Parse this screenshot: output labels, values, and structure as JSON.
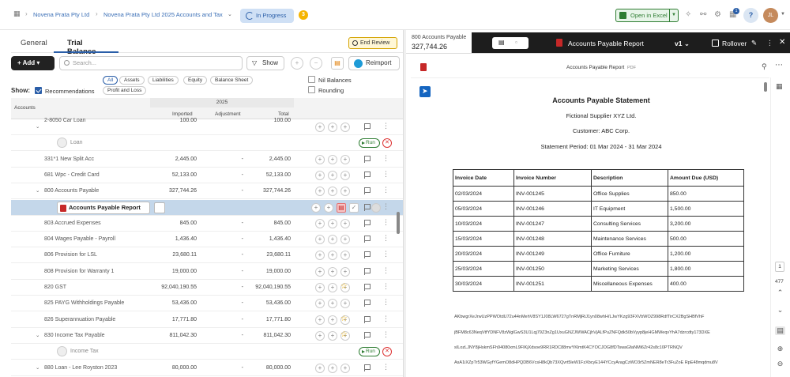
{
  "breadcrumb": {
    "client": "Novena Prata Pty Ltd",
    "file": "Novena Prata Pty Ltd 2025 Accounts and Tax",
    "status": "In Progress",
    "status_count": "3"
  },
  "top_actions": {
    "open_excel": "Open in Excel",
    "notifications": "1",
    "help": "?",
    "user_initials": "JL"
  },
  "tabs": [
    {
      "label": "General"
    },
    {
      "label": "Trial Balance"
    }
  ],
  "end_review": "End Review",
  "toolbar": {
    "add": "Add",
    "search_placeholder": "Search...",
    "show": "Show",
    "reimport": "Reimport"
  },
  "filters": {
    "show_label": "Show:",
    "recommendations": "Recommendations",
    "chips": [
      "All",
      "Assets",
      "Liabilities",
      "Equity",
      "Balance Sheet",
      "Profit and Loss"
    ],
    "nil_balances": "Nil Balances",
    "rounding": "Rounding"
  },
  "table": {
    "accounts_header": "Accounts",
    "year": "2025",
    "col_imported": "Imported",
    "col_adjustment": "Adjustment",
    "col_total": "Total"
  },
  "rows": [
    {
      "type": "account",
      "name": "2-8050 Car Loan",
      "imported": "100.00",
      "adjustment": "",
      "total": "100.00",
      "chev": true,
      "cut": true
    },
    {
      "type": "task",
      "name": "Loan",
      "run": "Run"
    },
    {
      "type": "account",
      "name": "331*1 New Split Acc",
      "imported": "2,445.00",
      "adjustment": "-",
      "total": "2,445.00"
    },
    {
      "type": "account",
      "name": "681 Wpc - Credit Card",
      "imported": "52,133.00",
      "adjustment": "-",
      "total": "52,133.00"
    },
    {
      "type": "account",
      "name": "800 Accounts Payable",
      "imported": "327,744.26",
      "adjustment": "-",
      "total": "327,744.26",
      "chev": true
    },
    {
      "type": "report",
      "name": "Accounts Payable Report"
    },
    {
      "type": "account",
      "name": "803 Accrued Expenses",
      "imported": "845.00",
      "adjustment": "-",
      "total": "845.00"
    },
    {
      "type": "account",
      "name": "804 Wages Payable - Payroll",
      "imported": "1,436.40",
      "adjustment": "-",
      "total": "1,436.40"
    },
    {
      "type": "account",
      "name": "806 Provision for LSL",
      "imported": "23,680.11",
      "adjustment": "-",
      "total": "23,680.11"
    },
    {
      "type": "account",
      "name": "808 Provision for Warranty 1",
      "imported": "19,000.00",
      "adjustment": "-",
      "total": "19,000.00"
    },
    {
      "type": "account",
      "name": "820 GST",
      "imported": "92,040,190.55",
      "adjustment": "-",
      "total": "92,040,190.55",
      "star": true
    },
    {
      "type": "account",
      "name": "825 PAYG Withholdings Payable",
      "imported": "53,436.00",
      "adjustment": "-",
      "total": "53,436.00"
    },
    {
      "type": "account",
      "name": "826 Superannuation Payable",
      "imported": "17,771.80",
      "adjustment": "-",
      "total": "17,771.80",
      "star": true
    },
    {
      "type": "account",
      "name": "830 Income Tax Payable",
      "imported": "811,042.30",
      "adjustment": "-",
      "total": "811,042.30",
      "chev": true,
      "star": true
    },
    {
      "type": "task",
      "name": "Income Tax",
      "run": "Run"
    },
    {
      "type": "account",
      "name": "880 Loan - Lee Royston 2023",
      "imported": "80,000.00",
      "adjustment": "-",
      "total": "80,000.00",
      "chev": true
    }
  ],
  "right_panel": {
    "account_name": "800 Accounts Payable",
    "account_amount": "327,744.26",
    "doc_title": "Accounts Payable Report",
    "version": "v1",
    "rollover": "Rollover",
    "viewer_title": "Accounts Payable Report",
    "viewer_ext": "PDF"
  },
  "document": {
    "heading": "Accounts Payable Statement",
    "supplier": "Fictional Supplier XYZ Ltd.",
    "customer": "Customer: ABC Corp.",
    "period": "Statement Period: 01 Mar 2024 - 31 Mar 2024",
    "headers": [
      "Invoice Date",
      "Invoice Number",
      "Description",
      "Amount Due (USD)"
    ],
    "invoices": [
      [
        "02/03/2024",
        "INV-001245",
        "Office Supplies",
        "850.00"
      ],
      [
        "05/03/2024",
        "INV-001246",
        "IT Equipment",
        "1,500.00"
      ],
      [
        "10/03/2024",
        "INV-001247",
        "Consulting Services",
        "3,200.00"
      ],
      [
        "15/03/2024",
        "INV-001248",
        "Maintenance Services",
        "500.00"
      ],
      [
        "20/03/2024",
        "INV-001249",
        "Office Furniture",
        "1,200.00"
      ],
      [
        "25/03/2024",
        "INV-001250",
        "Marketing Services",
        "1,800.00"
      ],
      [
        "30/03/2024",
        "INV-001251",
        "Miscellaneous Expenses",
        "400.00"
      ]
    ],
    "encoded": [
      "AKbwgrXeJrwUzPPWOtdU72u44nMehV8SY1J08LW6727gTnRMjRiJ1yn08whH/LJwYKzg93FXVbWOZ998RdfTirCX2BgSHBfVhF",
      "jBFM8c63NeqVtfYDNFV8zWglGwS3U1Lqj79Z3nZg1UxuGNZJWWACjhVjALfPuZNFQdk50bVyyp8jeHGMWeqvYhA7dzrcdty173DXE",
      "sILozLJNY8jHskmSFh94080xmL9FIKjXdsoe9RR1RDC88mvYKlmtK4CYOCJOG8fDTswaGfaNMi6Zr42s8c10PTRNQV",
      "AsA1iXZpTr53WGyfYGemO8dHPQDB6VcsH8kQb73XQvrt5leW1FzXbcyE144YCcyAragCzWO3r5ZmNER8eTr3FuZoE RpE48mqdmu8V"
    ]
  },
  "viewer_side": {
    "page": "1",
    "total_pages": "477"
  }
}
